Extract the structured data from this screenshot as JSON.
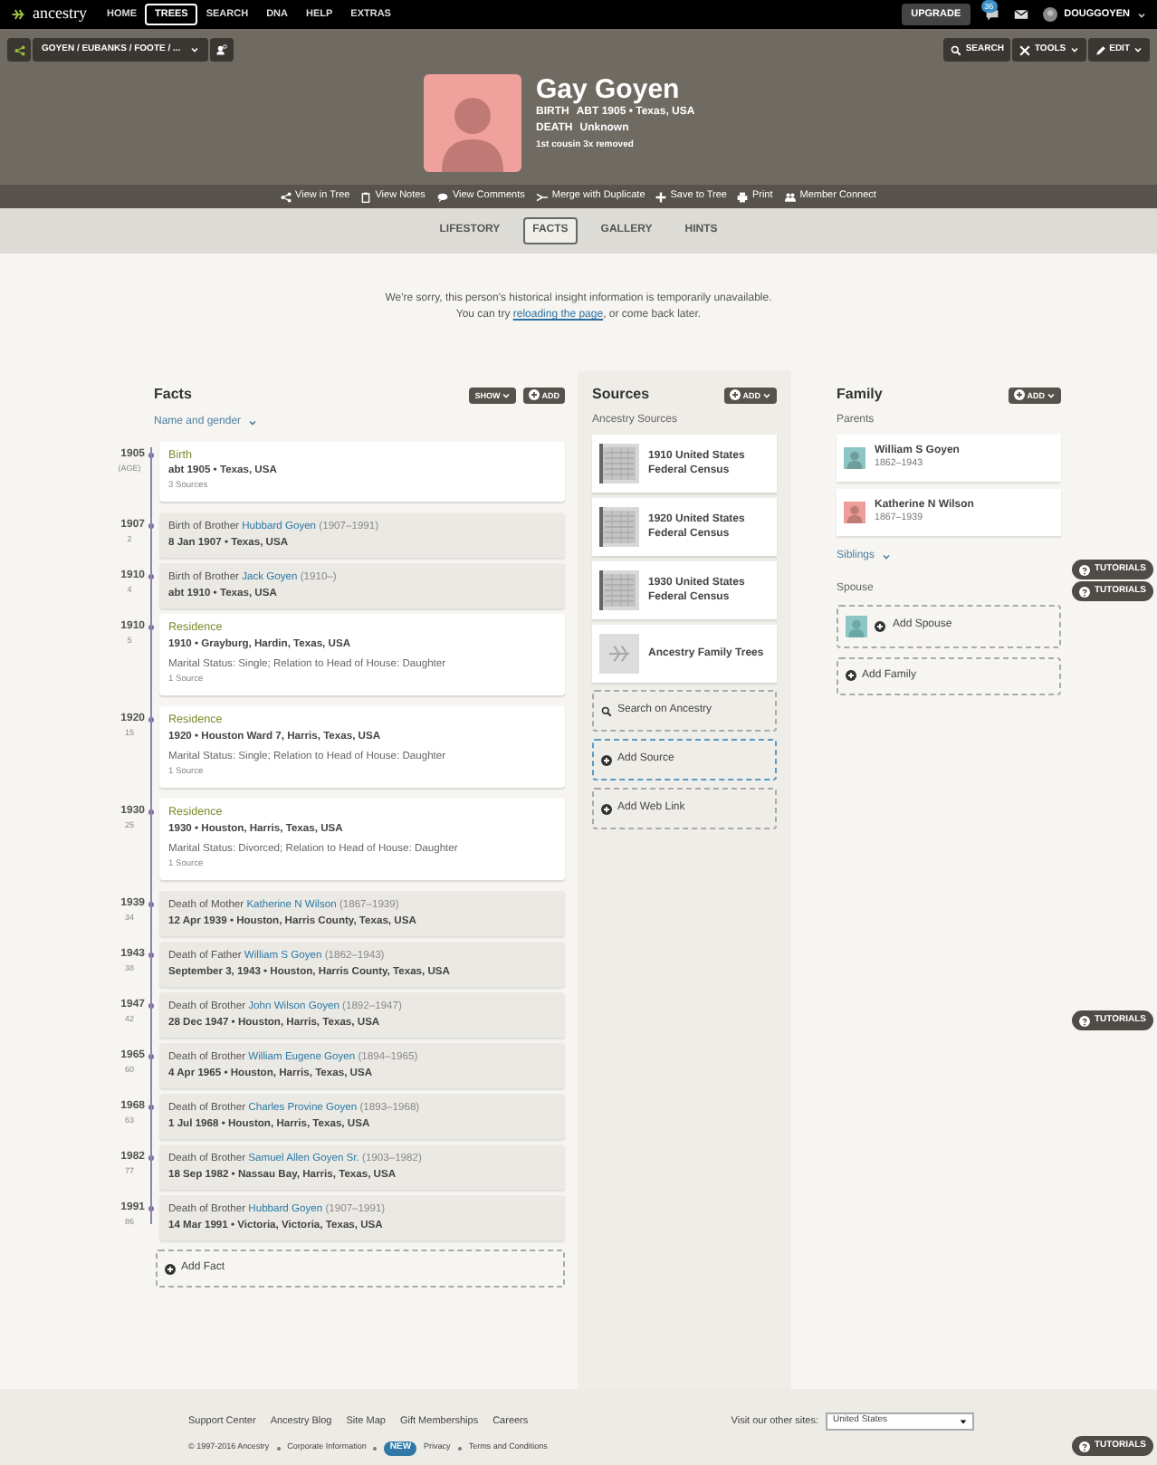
{
  "top_nav": {
    "logo": "ancestry",
    "items": [
      {
        "label": "HOME",
        "selected": false
      },
      {
        "label": "TREES",
        "selected": true
      },
      {
        "label": "SEARCH",
        "selected": false
      },
      {
        "label": "DNA",
        "selected": false
      },
      {
        "label": "HELP",
        "selected": false
      },
      {
        "label": "EXTRAS",
        "selected": false
      }
    ],
    "upgrade": "UPGRADE",
    "notifications": "36",
    "user": "DOUGGOYEN"
  },
  "tree_bar": {
    "tree_name": "GOYEN / EUBANKS / FOOTE / ...",
    "buttons": [
      "SEARCH",
      "TOOLS",
      "EDIT"
    ]
  },
  "person": {
    "name": "Gay Goyen",
    "facts": [
      {
        "label": "BIRTH",
        "value": "ABT 1905 • Texas, USA"
      },
      {
        "label": "DEATH",
        "value": "Unknown"
      }
    ],
    "relationship": "1st cousin 3x removed"
  },
  "actions": [
    "View in Tree",
    "View Notes",
    "View Comments",
    "Merge with Duplicate",
    "Save to Tree",
    "Print",
    "Member Connect"
  ],
  "tabs": [
    {
      "label": "LIFESTORY",
      "selected": false
    },
    {
      "label": "FACTS",
      "selected": true
    },
    {
      "label": "GALLERY",
      "selected": false
    },
    {
      "label": "HINTS",
      "selected": false
    }
  ],
  "notice": {
    "line1": "We're sorry, this person's historical insight information is temporarily unavailable.",
    "line2_before": "You can try",
    "link": "reloading the page",
    "line2_after": ", or come back later."
  },
  "facts": {
    "title": "Facts",
    "show": "SHOW",
    "add": "ADD",
    "name_gender": "Name and gender",
    "add_fact": "Add Fact",
    "items": [
      {
        "kind": "personal",
        "year": "1905",
        "age": "(AGE)",
        "title": "Birth",
        "line": "abt 1905 • Texas, USA",
        "sources": "3 Sources"
      },
      {
        "kind": "family",
        "year": "1907",
        "age": "2",
        "prefix": "Birth of Brother",
        "person": "Hubbard Goyen",
        "years": "(1907–1991)",
        "line": "8 Jan 1907 • Texas, USA"
      },
      {
        "kind": "family",
        "year": "1910",
        "age": "4",
        "prefix": "Birth of Brother",
        "person": "Jack Goyen",
        "years": "(1910–)",
        "line": "abt 1910 • Texas, USA"
      },
      {
        "kind": "personal",
        "year": "1910",
        "age": "5",
        "title": "Residence",
        "line": "1910 • Grayburg, Hardin, Texas, USA",
        "note": "Marital Status: Single; Relation to Head of House: Daughter",
        "sources": "1 Source"
      },
      {
        "kind": "personal",
        "year": "1920",
        "age": "15",
        "title": "Residence",
        "line": "1920 • Houston Ward 7, Harris, Texas, USA",
        "note": "Marital Status: Single; Relation to Head of House: Daughter",
        "sources": "1 Source"
      },
      {
        "kind": "personal",
        "year": "1930",
        "age": "25",
        "title": "Residence",
        "line": "1930 • Houston, Harris, Texas, USA",
        "note": "Marital Status: Divorced; Relation to Head of House: Daughter",
        "sources": "1 Source"
      },
      {
        "kind": "family",
        "year": "1939",
        "age": "34",
        "prefix": "Death of Mother",
        "person": "Katherine N Wilson",
        "years": "(1867–1939)",
        "line": "12 Apr 1939 • Houston, Harris County, Texas, USA"
      },
      {
        "kind": "family",
        "year": "1943",
        "age": "38",
        "prefix": "Death of Father",
        "person": "William S Goyen",
        "years": "(1862–1943)",
        "line": "September 3, 1943 • Houston, Harris County, Texas, USA"
      },
      {
        "kind": "family",
        "year": "1947",
        "age": "42",
        "prefix": "Death of Brother",
        "person": "John Wilson Goyen",
        "years": "(1892–1947)",
        "line": "28 Dec 1947 • Houston, Harris, Texas, USA"
      },
      {
        "kind": "family",
        "year": "1965",
        "age": "60",
        "prefix": "Death of Brother",
        "person": "William Eugene Goyen",
        "years": "(1894–1965)",
        "line": "4 Apr 1965 • Houston, Harris, Texas, USA"
      },
      {
        "kind": "family",
        "year": "1968",
        "age": "63",
        "prefix": "Death of Brother",
        "person": "Charles Provine Goyen",
        "years": "(1893–1968)",
        "line": "1 Jul 1968 • Houston, Harris, Texas, USA"
      },
      {
        "kind": "family",
        "year": "1982",
        "age": "77",
        "prefix": "Death of Brother",
        "person": "Samuel Allen Goyen Sr.",
        "years": "(1903–1982)",
        "line": "18 Sep 1982 • Nassau Bay, Harris, Texas, USA"
      },
      {
        "kind": "family",
        "year": "1991",
        "age": "86",
        "prefix": "Death of Brother",
        "person": "Hubbard Goyen",
        "years": "(1907–1991)",
        "line": "14 Mar 1991 • Victoria, Victoria, Texas, USA"
      }
    ]
  },
  "sources": {
    "title": "Sources",
    "add": "ADD",
    "subtitle": "Ancestry Sources",
    "items": [
      {
        "kind": "record",
        "label": "1910 United States Federal Census"
      },
      {
        "kind": "record",
        "label": "1920 United States Federal Census"
      },
      {
        "kind": "record",
        "label": "1930 United States Federal Census"
      },
      {
        "kind": "trees",
        "label": "Ancestry Family Trees"
      }
    ],
    "actions": [
      {
        "kind": "search",
        "label": "Search on Ancestry"
      },
      {
        "kind": "add",
        "label": "Add Source",
        "selected": true
      },
      {
        "kind": "add",
        "label": "Add Web Link",
        "selected": false
      }
    ]
  },
  "family": {
    "title": "Family",
    "add": "ADD",
    "parents_label": "Parents",
    "parents": [
      {
        "name": "William S Goyen",
        "years": "1862–1943",
        "color": "#8cc5c3"
      },
      {
        "name": "Katherine N Wilson",
        "years": "1867–1939",
        "color": "#ef9d98"
      }
    ],
    "siblings": "Siblings",
    "spouse_label": "Spouse",
    "add_spouse": "Add Spouse",
    "add_family": "Add Family"
  },
  "footer": {
    "links": [
      "Support Center",
      "Ancestry Blog",
      "Site Map",
      "Gift Memberships",
      "Careers"
    ],
    "other_sites_label": "Visit our other sites:",
    "other_sites_value": "United States",
    "copyright": "© 1997-2016 Ancestry",
    "corporate": "Corporate Information",
    "new_badge": "NEW",
    "privacy": "Privacy",
    "terms": "Terms and Conditions"
  },
  "tutorials": [
    "TUTORIALS",
    "TUTORIALS",
    "TUTORIALS",
    "TUTORIALS"
  ]
}
